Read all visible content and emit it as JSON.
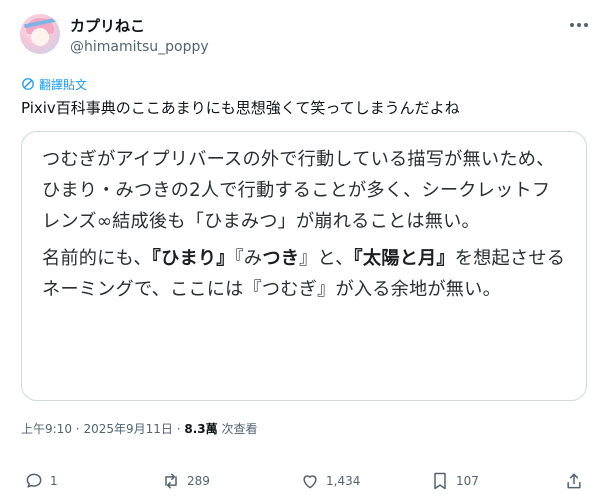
{
  "author": {
    "display_name": "カプリねこ",
    "handle": "@himamitsu_poppy"
  },
  "translate_label": "翻譯貼文",
  "post_text": "Pixiv百科事典のここあまりにも思想強くて笑ってしまうんだよね",
  "quote": {
    "line1": "つむぎがアイプリバースの外で行動している描写が無いため、ひまり・みつきの2人で行動することが多く、シークレットフレンズ∞結成後も「ひまみつ」が崩れることは無い。",
    "p2_before": "名前的にも、",
    "p2_bold1": "『ひまり』",
    "p2_mid1": "『み",
    "p2_bold2": "つき",
    "p2_mid2": "』と、",
    "p2_bold3": "『太陽と月』",
    "p2_after": "を想起させるネーミングで、ここには『つむぎ』が入る余地が無い。"
  },
  "meta": {
    "time": "上午9:10",
    "separator1": "·",
    "date": "2025年9月11日",
    "separator2": "·",
    "views": "8.3萬",
    "views_label": "次查看"
  },
  "actions": {
    "replies": "1",
    "reposts": "289",
    "likes": "1,434",
    "bookmarks": "107"
  },
  "colors": {
    "link": "#1d9bf0",
    "muted": "#536471",
    "border": "#cfd9de"
  }
}
